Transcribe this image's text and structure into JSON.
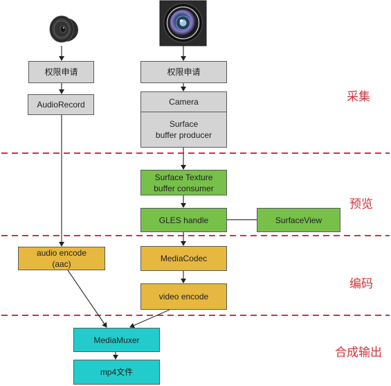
{
  "colors": {
    "capture_box": "#d4d4d4",
    "preview_box": "#77c04a",
    "encode_box": "#e6b840",
    "mux_box": "#22cccc",
    "stage_divider": "#d0323c",
    "stage_label": "#d0323c",
    "connector": "#333333"
  },
  "icons": {
    "audio_source": "speaker-icon",
    "video_source": "camera-lens-icon"
  },
  "stages": [
    {
      "id": "capture",
      "label": "采集"
    },
    {
      "id": "preview",
      "label": "预览"
    },
    {
      "id": "encode",
      "label": "编码"
    },
    {
      "id": "mux",
      "label": "合成输出"
    }
  ],
  "nodes": {
    "audio_permission": {
      "lines": [
        "权限申请"
      ]
    },
    "audio_record": {
      "lines": [
        "AudioRecord"
      ]
    },
    "video_permission": {
      "lines": [
        "权限申请"
      ]
    },
    "camera": {
      "lines": [
        "Camera"
      ]
    },
    "surface_producer": {
      "lines": [
        "Surface",
        "buffer producer"
      ]
    },
    "surface_texture": {
      "lines": [
        "Surface Texture",
        "buffer consumer"
      ]
    },
    "gles_handle": {
      "lines": [
        "GLES handle"
      ]
    },
    "surface_view": {
      "lines": [
        "SurfaceView"
      ]
    },
    "audio_encode": {
      "lines": [
        "audio encode",
        "(aac)"
      ]
    },
    "media_codec": {
      "lines": [
        "MediaCodec"
      ]
    },
    "video_encode": {
      "lines": [
        "video encode"
      ]
    },
    "media_muxer": {
      "lines": [
        "MediaMuxer"
      ]
    },
    "mp4_file": {
      "lines": [
        "mp4文件"
      ]
    }
  },
  "edges": [
    {
      "from": "speaker",
      "to": "audio_permission",
      "arrow": true
    },
    {
      "from": "audio_permission",
      "to": "audio_record",
      "arrow": true
    },
    {
      "from": "audio_record",
      "to": "audio_encode",
      "arrow": true
    },
    {
      "from": "audio_encode",
      "to": "media_muxer",
      "arrow": true
    },
    {
      "from": "camera_lens",
      "to": "video_permission",
      "arrow": true
    },
    {
      "from": "video_permission",
      "to": "camera",
      "arrow": true
    },
    {
      "from": "surface_producer",
      "to": "surface_texture",
      "arrow": true
    },
    {
      "from": "surface_texture",
      "to": "gles_handle",
      "arrow": true
    },
    {
      "from": "gles_handle",
      "to": "surface_view",
      "arrow": false
    },
    {
      "from": "gles_handle",
      "to": "media_codec",
      "arrow": true
    },
    {
      "from": "media_codec",
      "to": "video_encode",
      "arrow": true
    },
    {
      "from": "video_encode",
      "to": "media_muxer",
      "arrow": true
    },
    {
      "from": "media_muxer",
      "to": "mp4_file",
      "arrow": true
    }
  ]
}
